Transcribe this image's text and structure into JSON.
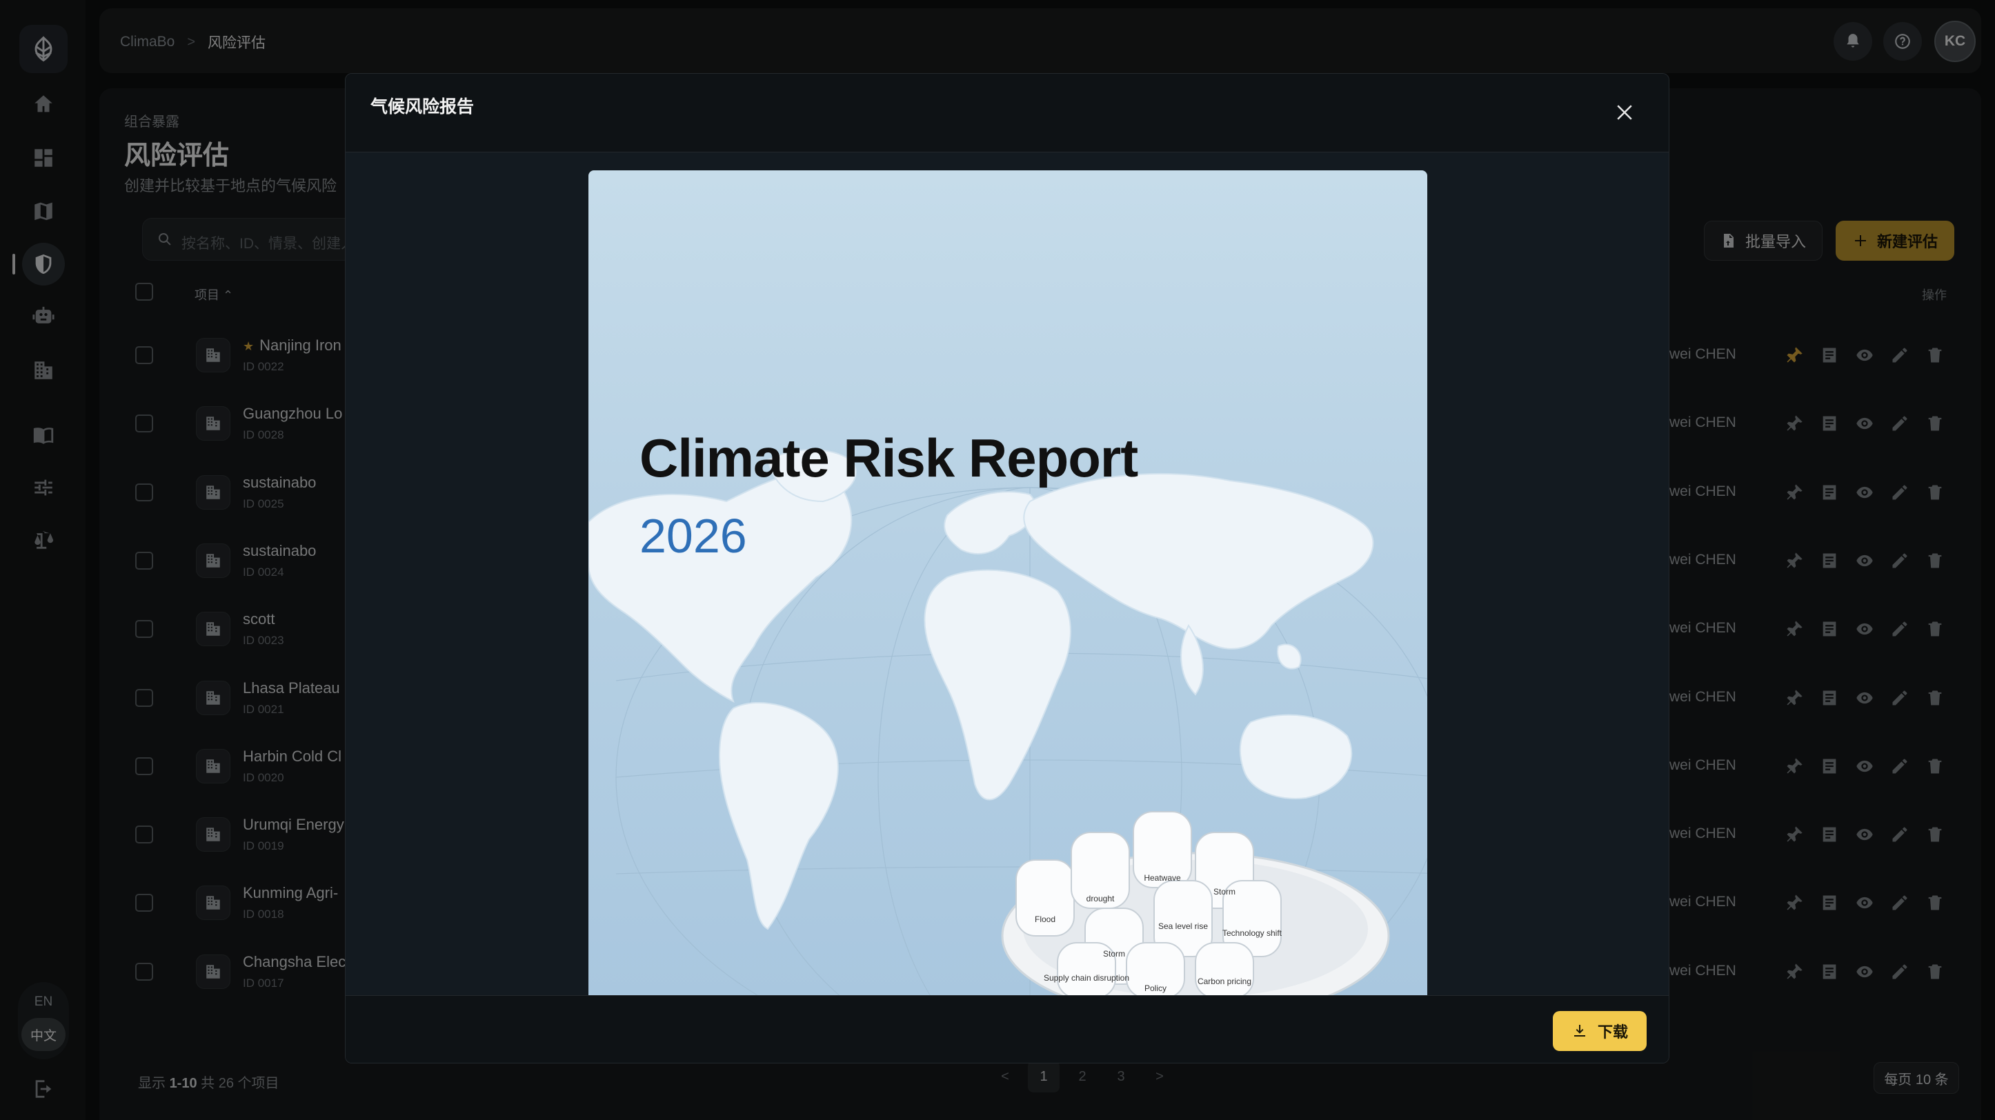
{
  "sidebar": {
    "lang_en": "EN",
    "lang_zh": "中文"
  },
  "topbar": {
    "breadcrumb_root": "ClimaBo",
    "breadcrumb_separator": ">",
    "breadcrumb_current": "风险评估",
    "avatar_initials": "KC"
  },
  "page": {
    "subtitle": "组合暴露",
    "title": "风险评估",
    "description": "创建并比较基于地点的气候风险",
    "search_placeholder": "按名称、ID、情景、创建人",
    "import_button": "批量导入",
    "new_button": "新建评估",
    "column_item": "项目",
    "column_ops": "操作"
  },
  "rows": [
    {
      "name": "Nanjing Iron",
      "id": "ID 0022",
      "owner": "wei CHEN",
      "starred": "★"
    },
    {
      "name": "Guangzhou Lo",
      "id": "ID 0028",
      "owner": "wei CHEN"
    },
    {
      "name": "sustainabo",
      "id": "ID 0025",
      "owner": "wei CHEN"
    },
    {
      "name": "sustainabo",
      "id": "ID 0024",
      "owner": "wei CHEN"
    },
    {
      "name": "scott",
      "id": "ID 0023",
      "owner": "wei CHEN"
    },
    {
      "name": "Lhasa Plateau",
      "id": "ID 0021",
      "owner": "wei CHEN"
    },
    {
      "name": "Harbin Cold Cl",
      "id": "ID 0020",
      "owner": "wei CHEN"
    },
    {
      "name": "Urumqi Energy",
      "id": "ID 0019",
      "owner": "wei CHEN"
    },
    {
      "name": "Kunming Agri-",
      "id": "ID 0018",
      "owner": "wei CHEN"
    },
    {
      "name": "Changsha Elec",
      "id": "ID 0017",
      "owner": "wei CHEN"
    }
  ],
  "footer": {
    "count_prefix": "显示 ",
    "count_range": "1-10",
    "count_suffix": " 共 26 个项目",
    "pages": [
      "<",
      "1",
      "2",
      "3",
      ">"
    ],
    "per_page": "每页 10 条"
  },
  "modal": {
    "title": "气候风险报告",
    "download_button": "下载",
    "report_title": "Climate Risk Report",
    "report_year": "2026",
    "bottle_labels": [
      "drought",
      "Heatwave",
      "Storm",
      "Flood",
      "Storm",
      "Sea level rise",
      "Technology shift",
      "Supply chain disruption",
      "Policy",
      "Carbon pricing"
    ]
  },
  "colors": {
    "accent": "#b8932c",
    "download": "#f2c94c",
    "year_blue": "#2e6fb7"
  }
}
